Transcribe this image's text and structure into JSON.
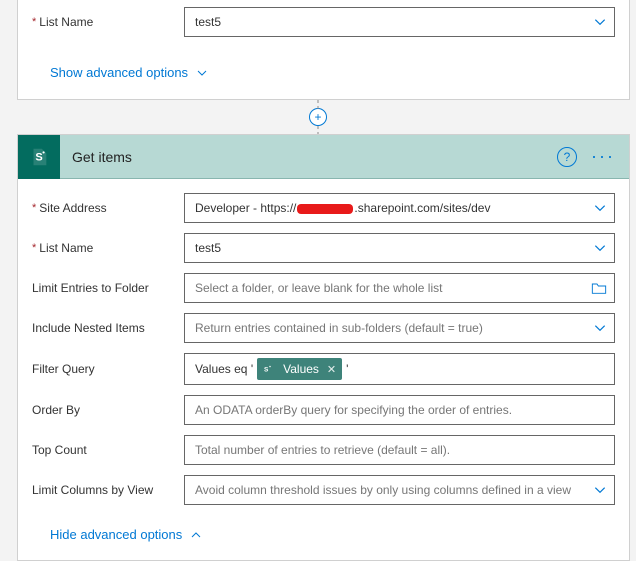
{
  "top_card": {
    "list_name_label": "List Name",
    "list_name_value": "test5",
    "advanced_label": "Show advanced options"
  },
  "action": {
    "title": "Get items"
  },
  "form": {
    "site_address": {
      "label": "Site Address",
      "value_prefix": "Developer - https://",
      "value_suffix": ".sharepoint.com/sites/dev"
    },
    "list_name": {
      "label": "List Name",
      "value": "test5"
    },
    "limit_folder": {
      "label": "Limit Entries to Folder",
      "placeholder": "Select a folder, or leave blank for the whole list"
    },
    "include_nested": {
      "label": "Include Nested Items",
      "placeholder": "Return entries contained in sub-folders (default = true)"
    },
    "filter_query": {
      "label": "Filter Query",
      "prefix_text": "Values eq '",
      "token_label": "Values",
      "suffix_text": "'"
    },
    "order_by": {
      "label": "Order By",
      "placeholder": "An ODATA orderBy query for specifying the order of entries."
    },
    "top_count": {
      "label": "Top Count",
      "placeholder": "Total number of entries to retrieve (default = all)."
    },
    "limit_columns": {
      "label": "Limit Columns by View",
      "placeholder": "Avoid column threshold issues by only using columns defined in a view"
    },
    "advanced_label": "Hide advanced options"
  }
}
